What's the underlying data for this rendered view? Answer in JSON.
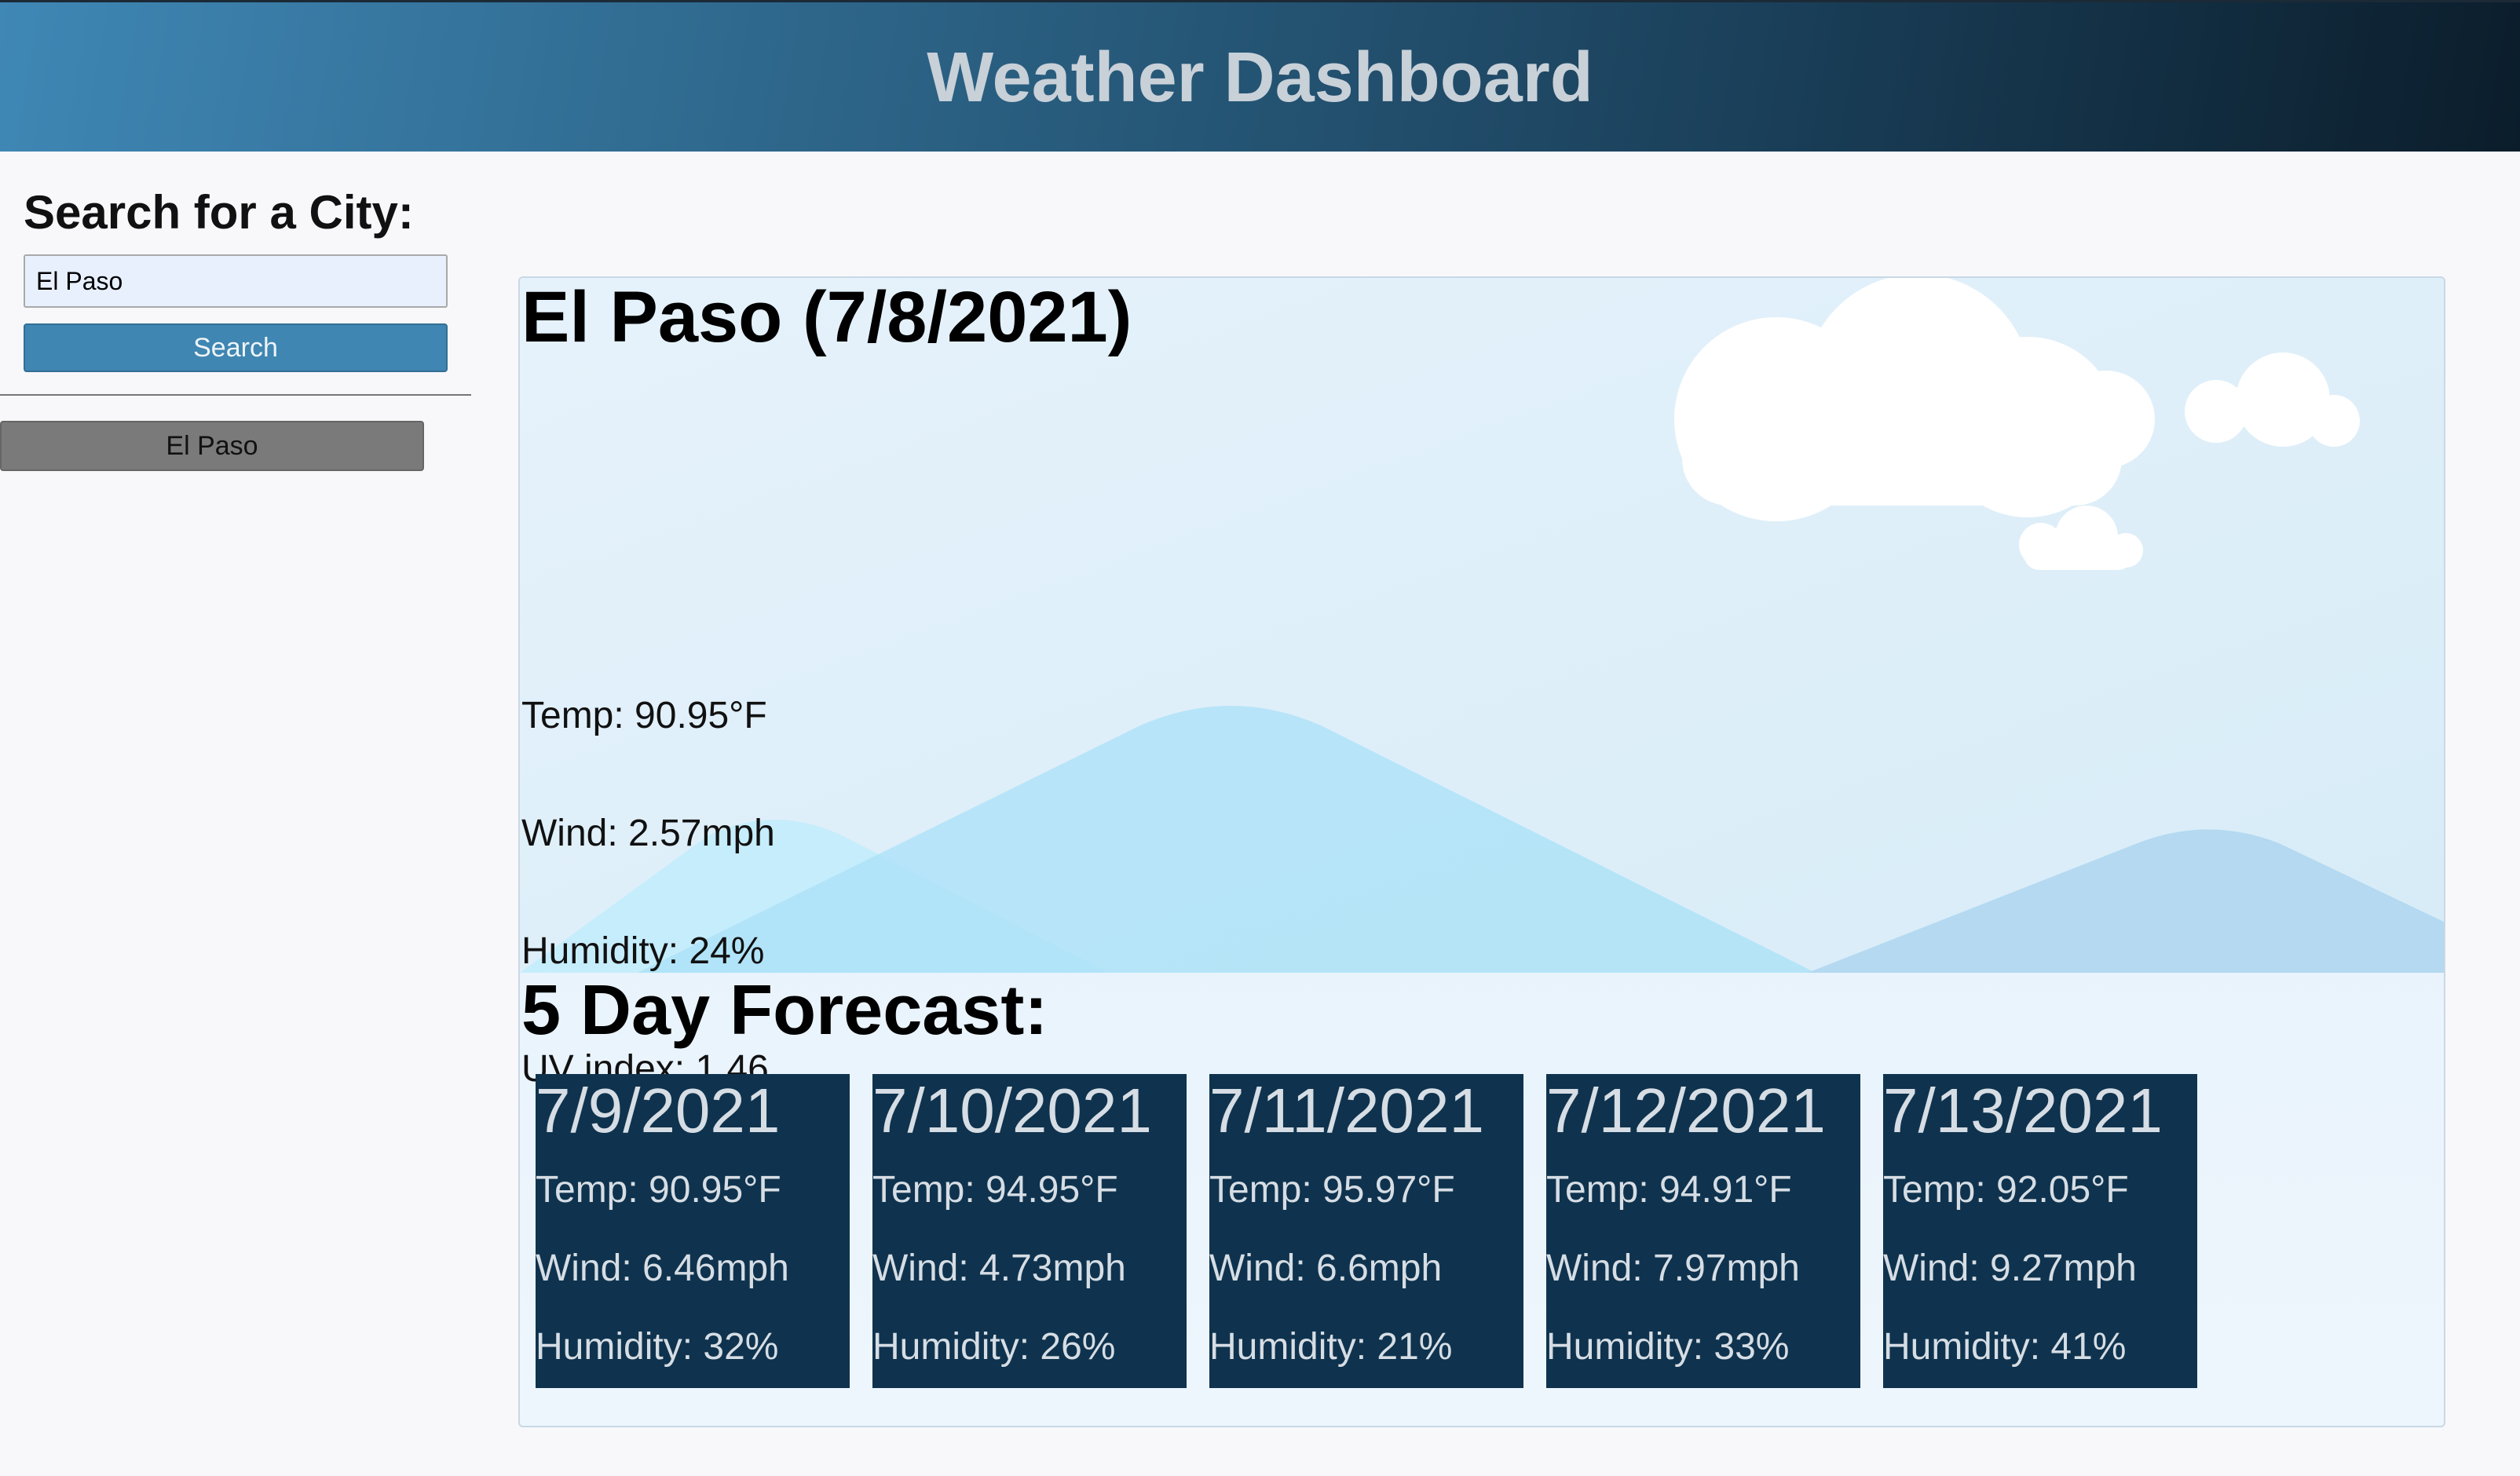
{
  "header": {
    "title": "Weather Dashboard"
  },
  "sidebar": {
    "heading": "Search for a City:",
    "search_value": "El Paso",
    "search_button": "Search",
    "history": [
      "El Paso"
    ]
  },
  "current": {
    "title": "El Paso (7/8/2021)",
    "temp": "Temp: 90.95°F",
    "wind": "Wind: 2.57mph",
    "humidity": "Humidity: 24%",
    "uv": "UV index: 1.46"
  },
  "forecast": {
    "heading": "5 Day Forecast:",
    "days": [
      {
        "date": "7/9/2021",
        "temp": "Temp: 90.95°F",
        "wind": "Wind: 6.46mph",
        "humidity": "Humidity: 32%"
      },
      {
        "date": "7/10/2021",
        "temp": "Temp: 94.95°F",
        "wind": "Wind: 4.73mph",
        "humidity": "Humidity: 26%"
      },
      {
        "date": "7/11/2021",
        "temp": "Temp: 95.97°F",
        "wind": "Wind: 6.6mph",
        "humidity": "Humidity: 21%"
      },
      {
        "date": "7/12/2021",
        "temp": "Temp: 94.91°F",
        "wind": "Wind: 7.97mph",
        "humidity": "Humidity: 33%"
      },
      {
        "date": "7/13/2021",
        "temp": "Temp: 92.05°F",
        "wind": "Wind: 9.27mph",
        "humidity": "Humidity: 41%"
      }
    ]
  },
  "colors": {
    "header_gradient_start": "#3f87b5",
    "header_gradient_end": "#0b1d2b",
    "search_button": "#3f86b2",
    "history_button": "#7a7a7a",
    "forecast_card": "#0f334e"
  }
}
